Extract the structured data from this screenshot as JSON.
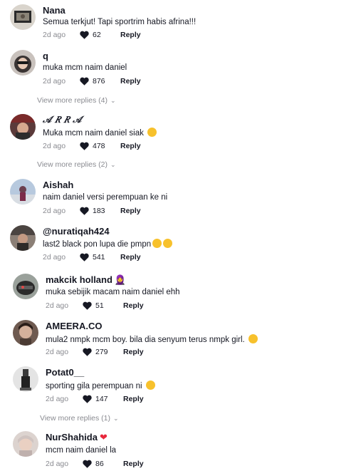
{
  "comments": [
    {
      "username": "Nana",
      "text": "Semua terkjut! Tapi sportrim habis afrina!!!",
      "date": "2d ago",
      "likes": "62",
      "reply": "Reply",
      "more": ""
    },
    {
      "username": "q",
      "text": "muka mcm naim daniel",
      "date": "2d ago",
      "likes": "876",
      "reply": "Reply",
      "more": "View more replies (4)"
    },
    {
      "username": "𝒜 𝑅 𝑅 𝒜",
      "text": "Muka mcm naim daniel siak",
      "date": "2d ago",
      "likes": "478",
      "reply": "Reply",
      "more": "View more replies (2)"
    },
    {
      "username": "Aishah",
      "text": "naim daniel versi perempuan ke ni",
      "date": "2d ago",
      "likes": "183",
      "reply": "Reply",
      "more": ""
    },
    {
      "username": "@nuratiqah424",
      "text": "last2 black pon lupa die pmpn",
      "date": "2d ago",
      "likes": "541",
      "reply": "Reply",
      "more": ""
    },
    {
      "username": "makcik holland",
      "text": "muka sebijik macam naim daniel ehh",
      "date": "2d ago",
      "likes": "51",
      "reply": "Reply",
      "more": ""
    },
    {
      "username": "AMEERA.CO",
      "text": "mula2 nmpk mcm boy. bila dia senyum terus nmpk girl.",
      "date": "2d ago",
      "likes": "279",
      "reply": "Reply",
      "more": ""
    },
    {
      "username": "Potat0__",
      "text": "sporting gila perempuan ni",
      "date": "2d ago",
      "likes": "147",
      "reply": "Reply",
      "more": "View more replies (1)"
    },
    {
      "username": "NurShahida",
      "text": "mcm naim daniel la",
      "date": "2d ago",
      "likes": "86",
      "reply": "Reply",
      "more": ""
    }
  ],
  "icons": {
    "like": "heart-icon",
    "expand": "chevron-down-icon",
    "emoji": "laughing-emoji-icon",
    "hijab": "woman-with-headscarf-emoji-icon",
    "love": "red-heart-emoji-icon"
  },
  "colors": {
    "text": "#161823",
    "muted": "#8a8b91",
    "heart": "#161823",
    "red_heart": "#e8283c",
    "emoji": "#f7c12c"
  }
}
